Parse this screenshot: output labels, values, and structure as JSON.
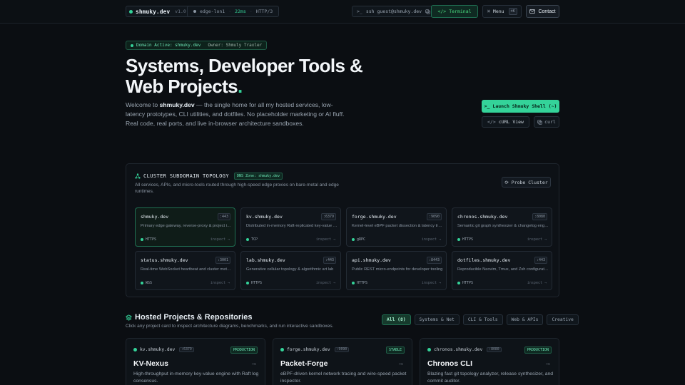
{
  "nav": {
    "brand": "shmuky.dev",
    "version": "v1.0",
    "edge_node": "edge-lon1",
    "latency": "22ms",
    "protocol": "HTTP/3",
    "ssh": "ssh guest@shmuky.dev",
    "terminal_label": "Terminal",
    "menu_label": "Menu",
    "menu_kbd": "⌘K",
    "contact_label": "Contact"
  },
  "hero": {
    "domain_badge": "Domain Active: shmuky.dev",
    "owner": "Owner: Shmuly Traxler",
    "title_line1": "Systems, Developer Tools &",
    "title_line2": "Web Projects",
    "title_dot": ".",
    "title_comma": ",",
    "desc_pre": "Welcome to ",
    "desc_bold": "shmuky.dev",
    "desc_post": " — the single home for all my hosted services, low-latency prototypes, CLI utilities, and dotfiles. No placeholder marketing or AI fluff. Real code, real ports, and live in-browser architecture sandboxes.",
    "launch_label": "Launch Shmuky Shell (~)",
    "curl_view_label": "cURL View",
    "curl_label": "curl"
  },
  "cluster": {
    "title": "CLUSTER SUBDOMAIN TOPOLOGY",
    "dns_badge": "DNS Zone: shmuky.dev",
    "desc": "All services, APIs, and micro-tools routed through high-speed edge proxies on bare-metal and edge runtimes.",
    "probe_label": "Probe Cluster",
    "inspect_label": "inspect →",
    "nodes": [
      {
        "name": "shmuky.dev",
        "port": ":443",
        "desc": "Primary edge gateway, reverse-proxy & project index",
        "proto": "HTTPS",
        "color": "#34d399"
      },
      {
        "name": "kv.shmuky.dev",
        "port": ":6379",
        "desc": "Distributed in-memory Raft-replicated key-value store",
        "proto": "TCP",
        "color": "#34d399"
      },
      {
        "name": "forge.shmuky.dev",
        "port": ":9090",
        "desc": "Kernel-level eBPF packet dissection & latency tracing",
        "proto": "gRPC",
        "color": "#34d399"
      },
      {
        "name": "chronos.shmuky.dev",
        "port": ":8080",
        "desc": "Semantic git graph synthesizer & changelog engine",
        "proto": "HTTPS",
        "color": "#34d399"
      },
      {
        "name": "status.shmuky.dev",
        "port": ":3001",
        "desc": "Real-time WebSocket heartbeat and cluster metrics",
        "proto": "WSS",
        "color": "#34d399"
      },
      {
        "name": "lab.shmuky.dev",
        "port": ":443",
        "desc": "Generative cellular topology & algorithmic art lab",
        "proto": "HTTPS",
        "color": "#34d399"
      },
      {
        "name": "api.shmuky.dev",
        "port": ":8443",
        "desc": "Public REST micro-endpoints for developer tooling",
        "proto": "HTTPS",
        "color": "#34d399"
      },
      {
        "name": "dotfiles.shmuky.dev",
        "port": ":443",
        "desc": "Reproducible Neovim, Tmux, and Zsh configurations",
        "proto": "HTTPS",
        "color": "#34d399"
      }
    ]
  },
  "projects": {
    "title": "Hosted Projects & Repositories",
    "subtitle": "Click any project card to inspect architecture diagrams, benchmarks, and run interactive sandboxes.",
    "filters": [
      "All (8)",
      "Systems & Net",
      "CLI & Tools",
      "Web & APIs",
      "Creative"
    ],
    "active_filter": 0,
    "cards": [
      {
        "host": "kv.shmuky.dev",
        "port": ":6379",
        "badge": "PRODUCTION",
        "name": "KV-Nexus",
        "desc": "High-throughput in-memory key-value engine with Raft log consensus."
      },
      {
        "host": "forge.shmuky.dev",
        "port": ":9090",
        "badge": "STABLE",
        "name": "Packet-Forge",
        "desc": "eBPF-driven kernel network tracing and wire-speed packet inspector."
      },
      {
        "host": "chronos.shmuky.dev",
        "port": ":8080",
        "badge": "PRODUCTION",
        "name": "Chronos CLI",
        "desc": "Blazing fast git topology analyzer, release synthesizer, and commit auditor."
      }
    ]
  },
  "colors": {
    "accent": "#34d399",
    "bg": "#0b0e12"
  }
}
